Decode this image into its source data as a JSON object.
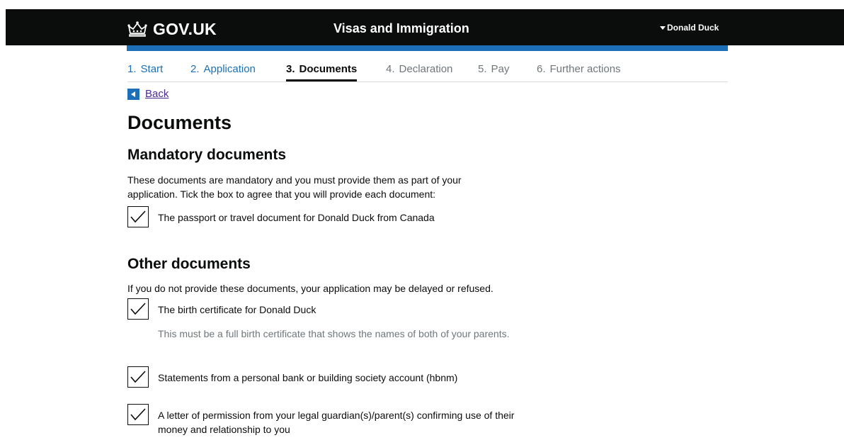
{
  "header": {
    "logo_text": "GOV.UK",
    "service_name": "Visas and Immigration",
    "user_name": "Donald Duck",
    "brand_color": "#1d70b8"
  },
  "steps": [
    {
      "number": "1.",
      "label": "Start",
      "state": "done"
    },
    {
      "number": "2.",
      "label": "Application",
      "state": "done"
    },
    {
      "number": "3.",
      "label": "Documents",
      "state": "current"
    },
    {
      "number": "4.",
      "label": "Declaration",
      "state": "todo"
    },
    {
      "number": "5.",
      "label": "Pay",
      "state": "todo"
    },
    {
      "number": "6.",
      "label": "Further actions",
      "state": "todo"
    }
  ],
  "back_link": "Back",
  "page_title": "Documents",
  "mandatory": {
    "heading": "Mandatory documents",
    "intro_line1": "These documents are mandatory and you must provide them as part of your",
    "intro_line2": "application. Tick the box to agree that you will provide each document:",
    "items": [
      {
        "label": "The passport or travel document for Donald Duck from Canada",
        "checked": true
      }
    ]
  },
  "other": {
    "heading": "Other documents",
    "intro": "If you do not provide these documents, your application may be delayed or refused.",
    "items": [
      {
        "label": "The birth certificate for Donald Duck",
        "hint": "This must be a full birth certificate that shows the names of both of your parents.",
        "checked": true
      },
      {
        "label": "Statements from a personal bank or building society account (hbnm)",
        "checked": true
      },
      {
        "label": "A letter of permission from your legal guardian(s)/parent(s) confirming use of their money and relationship to you",
        "checked": true
      }
    ]
  }
}
